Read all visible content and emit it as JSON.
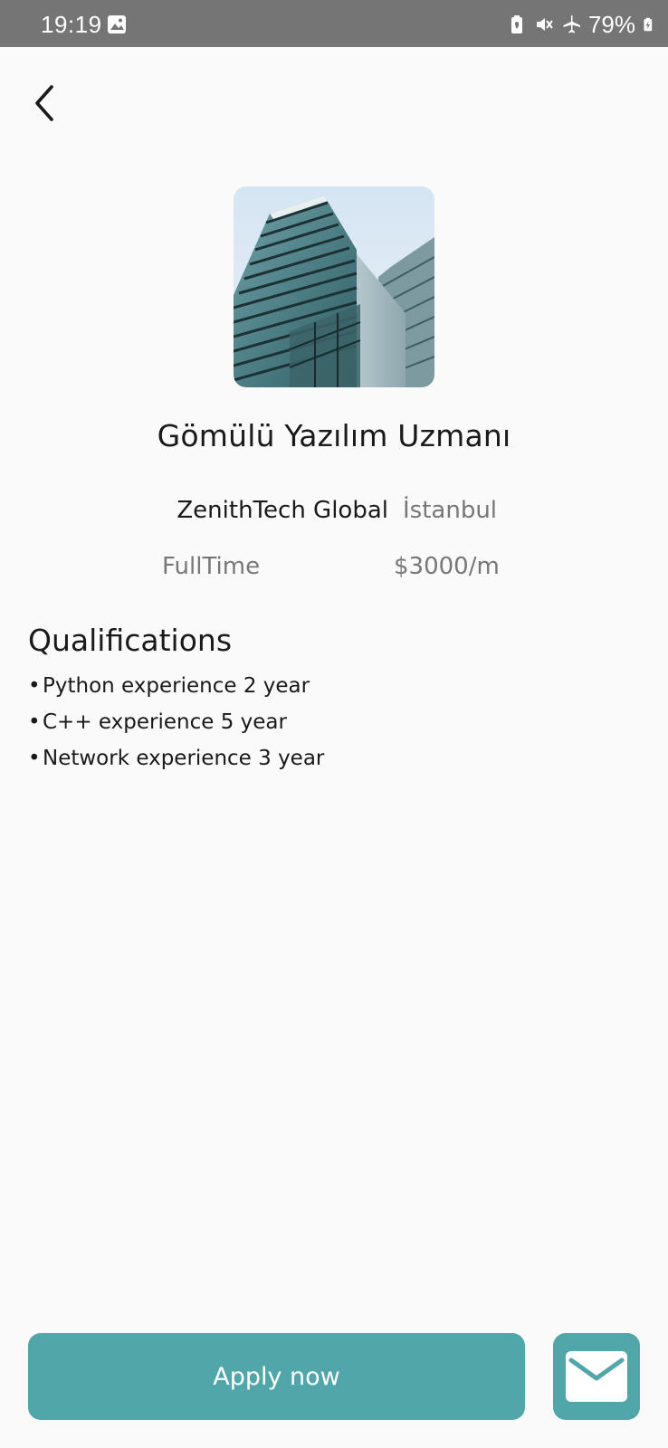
{
  "status_bar": {
    "time": "19:19",
    "battery_percent": "79%",
    "icons": [
      "image-icon",
      "battery-saver-icon",
      "vibrate-icon",
      "airplane-mode-icon",
      "battery-charging-icon"
    ]
  },
  "header": {
    "back_icon": "chevron-left-icon"
  },
  "job": {
    "image": "office-building-photo",
    "title": "Gömülü Yazılım Uzmanı",
    "company": "ZenithTech Global",
    "location": "İstanbul",
    "type": "FullTime",
    "salary": "$3000/m"
  },
  "qualifications": {
    "heading": "Qualifications",
    "bullet": "•",
    "items": [
      "Python experience 2 year",
      "C++ experience 5 year",
      "Network experience 3 year"
    ]
  },
  "actions": {
    "apply_label": "Apply now",
    "mail_icon": "mail-icon"
  },
  "colors": {
    "accent": "#50a6a8",
    "status_bar": "#757575",
    "background": "#fafafa",
    "text_primary": "#1a1a1a",
    "text_secondary": "#777777"
  }
}
